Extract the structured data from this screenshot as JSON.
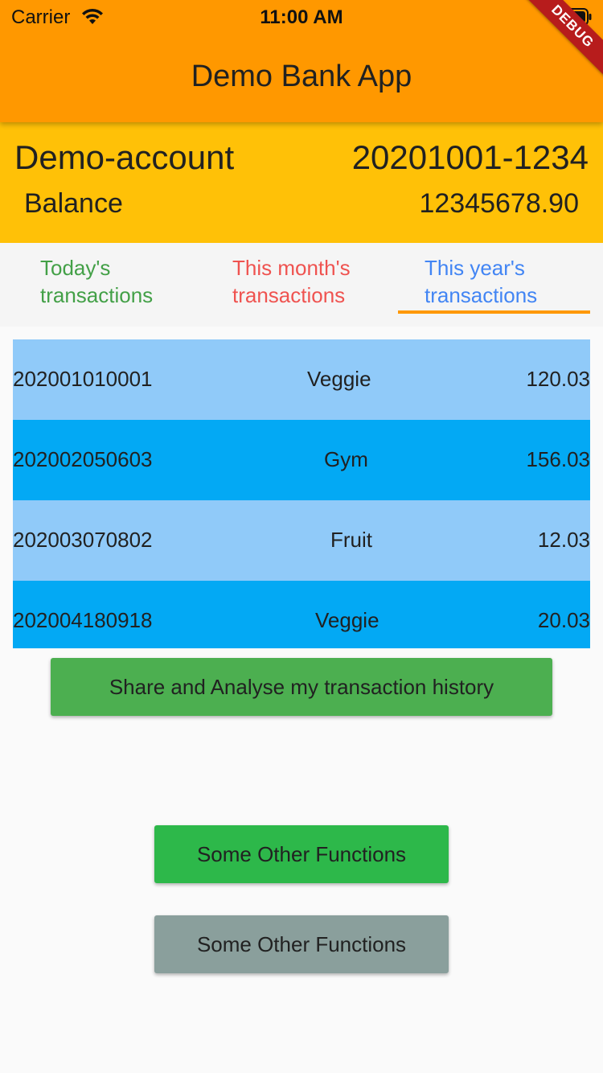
{
  "status_bar": {
    "carrier": "Carrier",
    "time": "11:00 AM"
  },
  "appbar": {
    "title": "Demo Bank App",
    "color": "#ff9800"
  },
  "debug_banner": "DEBUG",
  "account": {
    "name": "Demo-account",
    "number": "20201001-1234",
    "balance_label": "Balance",
    "balance_value": "12345678.90",
    "color": "#ffc107"
  },
  "tabs": [
    {
      "line1": "Today's",
      "line2": "transactions",
      "color": "#43a047"
    },
    {
      "line1": "This month's",
      "line2": "transactions",
      "color": "#ef5350"
    },
    {
      "line1": "This year's",
      "line2": "transactions",
      "color": "#4285f4",
      "selected": true
    }
  ],
  "transactions": [
    {
      "id": "202001010001",
      "category": "Veggie",
      "amount": "120.03"
    },
    {
      "id": "202002050603",
      "category": "Gym",
      "amount": "156.03"
    },
    {
      "id": "202003070802",
      "category": "Fruit",
      "amount": "12.03"
    },
    {
      "id": "202004180918",
      "category": "Veggie",
      "amount": "20.03"
    }
  ],
  "buttons": {
    "share": "Share and Analyse my transaction history",
    "other1": "Some Other Functions",
    "other2": "Some Other Functions"
  }
}
